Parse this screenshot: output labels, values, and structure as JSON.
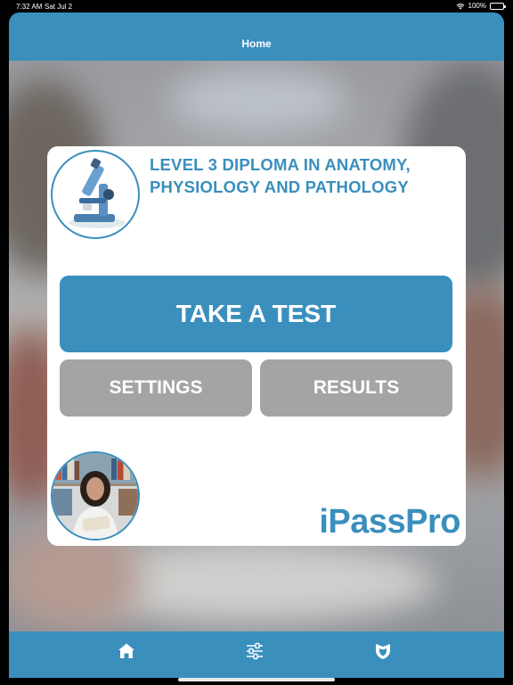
{
  "status_bar": {
    "time": "7:32 AM",
    "date": "Sat Jul 2",
    "battery": "100%"
  },
  "nav": {
    "title": "Home"
  },
  "card": {
    "heading_line1": "LEVEL 3 DIPLOMA IN ANATOMY,",
    "heading_line2": "PHYSIOLOGY AND PATHOLOGY",
    "take_test_label": "TAKE A TEST",
    "settings_label": "SETTINGS",
    "results_label": "RESULTS",
    "brand": "iPassPro"
  },
  "tab_bar": {
    "items": [
      {
        "icon": "home-icon"
      },
      {
        "icon": "sliders-icon"
      },
      {
        "icon": "shield-icon"
      }
    ]
  },
  "colors": {
    "accent": "#3a8fbd",
    "secondary_button": "#a4a4a4",
    "card": "#ffffff"
  }
}
